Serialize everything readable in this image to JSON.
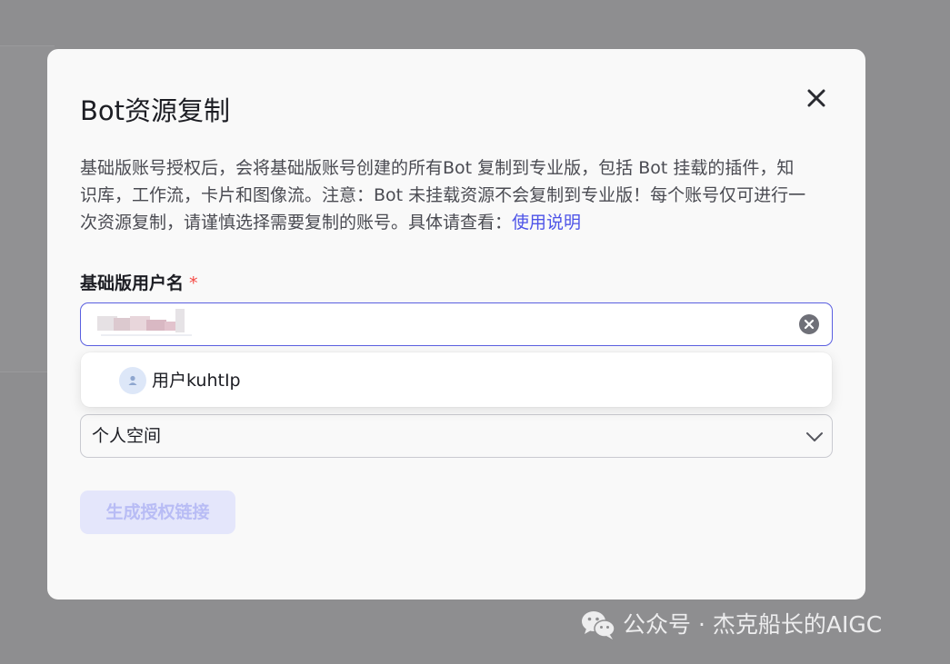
{
  "modal": {
    "title": "Bot资源复制",
    "description": "基础版账号授权后，会将基础版账号创建的所有Bot 复制到专业版，包括 Bot 挂载的插件，知识库，工作流，卡片和图像流。注意：Bot 未挂载资源不会复制到专业版！每个账号仅可进行一次资源复制，请谨慎选择需要复制的账号。具体请查看：",
    "help_link": "使用说明",
    "close_icon": "close-icon"
  },
  "username_field": {
    "label": "基础版用户名",
    "required_mark": "*",
    "value_obscured": true,
    "clear_icon": "clear-circle-icon"
  },
  "autocomplete": {
    "options": [
      {
        "label": "用户kuhtIp",
        "icon": "user-avatar-icon"
      }
    ]
  },
  "space_select": {
    "selected": "个人空间",
    "icon": "chevron-down-icon"
  },
  "actions": {
    "generate_link_label": "生成授权链接",
    "generate_link_disabled": true
  },
  "watermark": {
    "text": "公众号 · 杰克船长的AIGC",
    "icon": "wechat-icon"
  },
  "colors": {
    "accent": "#4d53e8",
    "required": "#f54a45",
    "overlay": "#8e8e90",
    "disabled_button_bg": "#e4e6fb",
    "disabled_button_text": "#b8bcf5"
  }
}
